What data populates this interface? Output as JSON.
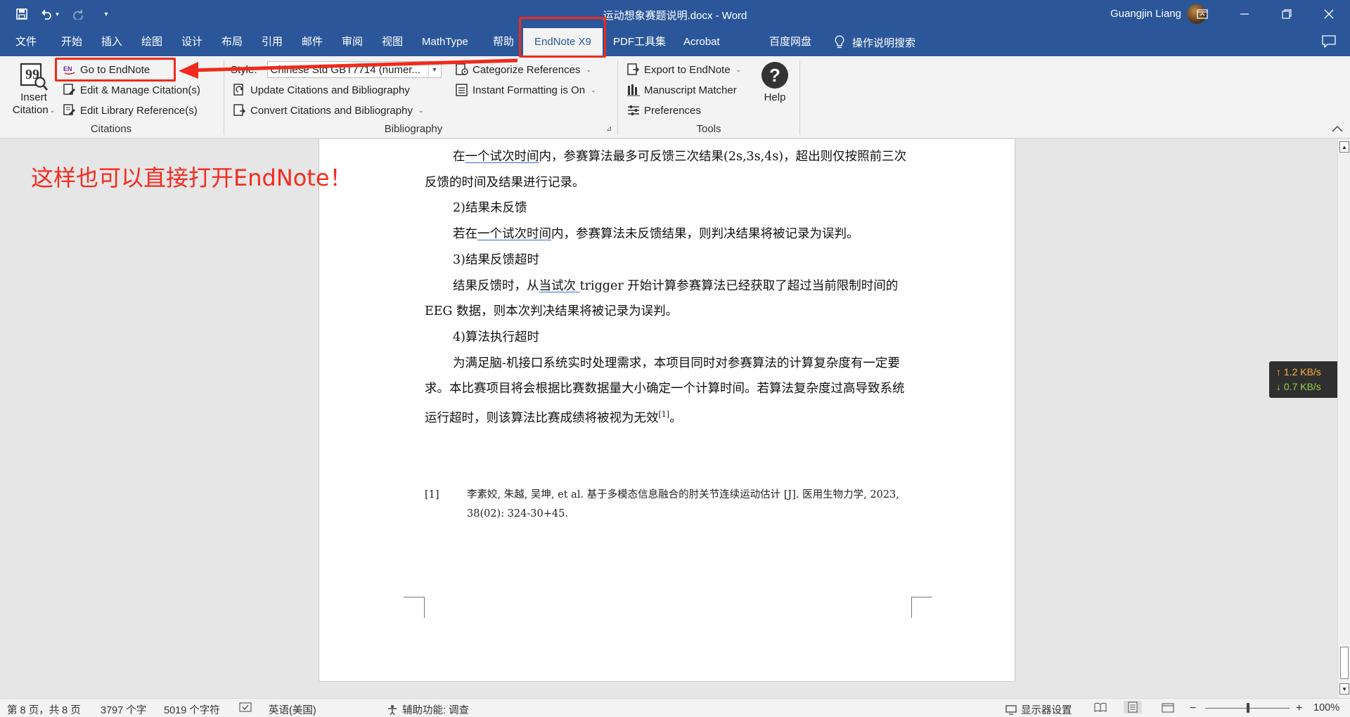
{
  "window": {
    "title": "运动想象赛题说明.docx  -  Word",
    "user": "Guangjin Liang"
  },
  "tabs": [
    "文件",
    "开始",
    "插入",
    "绘图",
    "设计",
    "布局",
    "引用",
    "邮件",
    "审阅",
    "视图",
    "MathType",
    "帮助",
    "EndNote X9",
    "PDF工具集",
    "Acrobat",
    "百度网盘"
  ],
  "active_tab": "EndNote X9",
  "tell_me": "操作说明搜索",
  "ribbon": {
    "citations": {
      "insert_citation": [
        "Insert",
        "Citation"
      ],
      "go_to_endnote": "Go to EndNote",
      "edit_manage": "Edit & Manage Citation(s)",
      "edit_library": "Edit Library Reference(s)",
      "group_label": "Citations"
    },
    "bibliography": {
      "style_label": "Style:",
      "style_value": "Chinese Std GBT7714 (numer...",
      "update": "Update Citations and Bibliography",
      "convert": "Convert Citations and Bibliography",
      "categorize": "Categorize References",
      "instant_formatting": "Instant Formatting is On",
      "group_label": "Bibliography"
    },
    "tools": {
      "export": "Export to EndNote",
      "manuscript": "Manuscript Matcher",
      "preferences": "Preferences",
      "help": "Help",
      "group_label": "Tools"
    }
  },
  "annotation": "这样也可以直接打开EndNote！",
  "document": {
    "p1_pre": "在",
    "p1_ul": "一个试次时间",
    "p1_post": "内，参赛算法最多可反馈三次结果(2s,3s,4s)，超出则仅按照前三次反馈的时间及结果进行记录。",
    "h2": "2)结果未反馈",
    "p2_pre": "若在",
    "p2_ul": "一个试次时间",
    "p2_post": "内，参赛算法未反馈结果，则判决结果将被记录为误判。",
    "h3": "3)结果反馈超时",
    "p3_pre": "结果反馈时，从",
    "p3_ul": "当试次 ",
    "p3_post": "trigger 开始计算参赛算法已经获取了超过当前限制时间的 EEG 数据，则本次判决结果将被记录为误判。",
    "h4": "4)算法执行超时",
    "p4": "为满足脑-机接口系统实时处理需求，本项目同时对参赛算法的计算复杂度有一定要求。本比赛项目将会根据比赛数据量大小确定一个计算时间。若算法复杂度过高导致系统运行超时，则该算法比赛成绩将被视为无效",
    "p4_cite": "[1]",
    "p4_end": "。",
    "ref_num": "[1]",
    "ref_text": "李素姣, 朱越, 吴坤, et al. 基于多模态信息融合的肘关节连续运动估计 [J]. 医用生物力学, 2023, 38(02): 324-30+45."
  },
  "netspeed": {
    "up": "↑ 1.2 KB/s",
    "down": "↓ 0.7 KB/s"
  },
  "status": {
    "page": "第 8 页，共 8 页",
    "words": "3797 个字",
    "chars": "5019 个字符",
    "language": "英语(美国)",
    "accessibility": "辅助功能: 调查",
    "display": "显示器设置",
    "zoom": "100%"
  },
  "colors": {
    "brand": "#2b579a",
    "annotation": "#f52b1f",
    "highlight": "#f02a1c"
  },
  "icons": [
    "save-icon",
    "undo-icon",
    "redo-icon",
    "customize-icon",
    "ribbon-display-icon",
    "minimize-icon",
    "restore-icon",
    "close-icon",
    "lightbulb-icon",
    "comment-icon",
    "insert-citation-icon",
    "endnote-icon",
    "edit-citation-icon",
    "edit-library-icon",
    "update-icon",
    "convert-icon",
    "categorize-icon",
    "instant-format-icon",
    "export-icon",
    "manuscript-icon",
    "preferences-icon",
    "help-icon",
    "collapse-ribbon-icon"
  ]
}
